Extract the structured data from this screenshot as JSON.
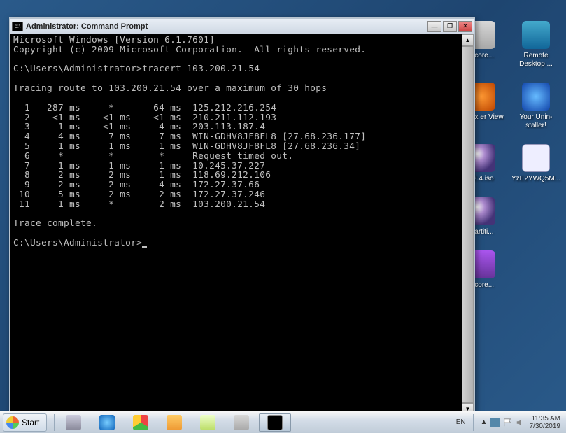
{
  "window": {
    "title": "Administrator: Command Prompt",
    "scrollbar_up": "▲",
    "scrollbar_down": "▼",
    "min": "—",
    "restore": "❐",
    "close": "✕"
  },
  "console": {
    "line_os": "Microsoft Windows [Version 6.1.7601]",
    "line_cr": "Copyright (c) 2009 Microsoft Corporation.  All rights reserved.",
    "prompt1_path": "C:\\Users\\Administrator>",
    "prompt1_cmd": "tracert 103.200.21.54",
    "tracing": "Tracing route to 103.200.21.54 over a maximum of 30 hops",
    "hops": [
      "  1   287 ms     *       64 ms  125.212.216.254",
      "  2    <1 ms    <1 ms    <1 ms  210.211.112.193",
      "  3     1 ms    <1 ms     4 ms  203.113.187.4",
      "  4     4 ms     7 ms     7 ms  WIN-GDHV8JF8FL8 [27.68.236.177]",
      "  5     1 ms     1 ms     1 ms  WIN-GDHV8JF8FL8 [27.68.236.34]",
      "  6     *        *        *     Request timed out.",
      "  7     1 ms     1 ms     1 ms  10.245.37.227",
      "  8     2 ms     2 ms     1 ms  118.69.212.106",
      "  9     2 ms     2 ms     4 ms  172.27.37.66",
      " 10     5 ms     2 ms     2 ms  172.27.37.246",
      " 11     1 ms     *        2 ms  103.200.21.54"
    ],
    "complete": "Trace complete.",
    "prompt2_path": "C:\\Users\\Administrator>"
  },
  "desktop": {
    "items": [
      {
        "label": "k-core..."
      },
      {
        "label": "Remote Desktop ..."
      },
      {
        "label": "reLinx er View"
      },
      {
        "label": "Your Unin-staller!"
      },
      {
        "label": "22.4.iso"
      },
      {
        "label": "YzE2YWQ5M..."
      },
      {
        "label": "lpartiti..."
      },
      {
        "label": ""
      },
      {
        "label": "k-core..."
      },
      {
        "label": ""
      }
    ]
  },
  "taskbar": {
    "start": "Start",
    "lang": "EN",
    "tray_chevron": "▲",
    "time": "11:35 AM",
    "date": "7/30/2019"
  }
}
